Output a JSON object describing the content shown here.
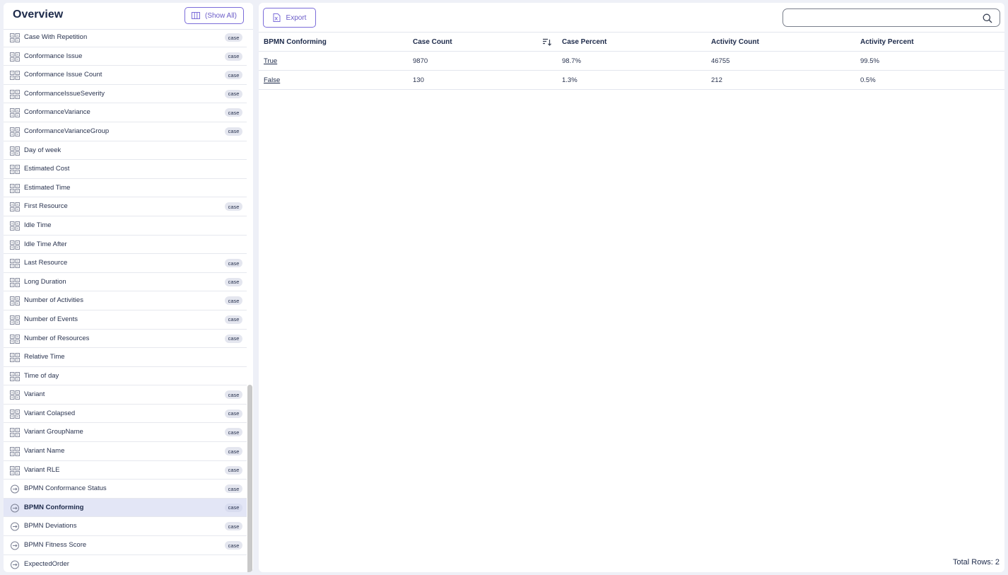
{
  "sidebar": {
    "title": "Overview",
    "show_all_label": "(Show All)",
    "items": [
      {
        "label": "Case With Repetition",
        "tag": "case",
        "icon": "grid-icon"
      },
      {
        "label": "Conformance Issue",
        "tag": "case",
        "icon": "grid-icon"
      },
      {
        "label": "Conformance Issue Count",
        "tag": "case",
        "icon": "grid-icon"
      },
      {
        "label": "ConformanceIssueSeverity",
        "tag": "case",
        "icon": "grid-icon"
      },
      {
        "label": "ConformanceVariance",
        "tag": "case",
        "icon": "grid-icon"
      },
      {
        "label": "ConformanceVarianceGroup",
        "tag": "case",
        "icon": "grid-icon"
      },
      {
        "label": "Day of week",
        "tag": "",
        "icon": "grid-icon"
      },
      {
        "label": "Estimated Cost",
        "tag": "",
        "icon": "grid-icon"
      },
      {
        "label": "Estimated Time",
        "tag": "",
        "icon": "grid-icon"
      },
      {
        "label": "First Resource",
        "tag": "case",
        "icon": "grid-icon"
      },
      {
        "label": "Idle Time",
        "tag": "",
        "icon": "grid-icon"
      },
      {
        "label": "Idle Time After",
        "tag": "",
        "icon": "grid-icon"
      },
      {
        "label": "Last Resource",
        "tag": "case",
        "icon": "grid-icon"
      },
      {
        "label": "Long Duration",
        "tag": "case",
        "icon": "grid-icon"
      },
      {
        "label": "Number of Activities",
        "tag": "case",
        "icon": "grid-icon"
      },
      {
        "label": "Number of Events",
        "tag": "case",
        "icon": "grid-icon"
      },
      {
        "label": "Number of Resources",
        "tag": "case",
        "icon": "grid-icon"
      },
      {
        "label": "Relative Time",
        "tag": "",
        "icon": "grid-icon"
      },
      {
        "label": "Time of day",
        "tag": "",
        "icon": "grid-icon"
      },
      {
        "label": "Variant",
        "tag": "case",
        "icon": "grid-icon"
      },
      {
        "label": "Variant Colapsed",
        "tag": "case",
        "icon": "grid-icon"
      },
      {
        "label": "Variant GroupName",
        "tag": "case",
        "icon": "grid-icon"
      },
      {
        "label": "Variant Name",
        "tag": "case",
        "icon": "grid-icon"
      },
      {
        "label": "Variant RLE",
        "tag": "case",
        "icon": "grid-icon"
      },
      {
        "label": "BPMN Conformance Status",
        "tag": "case",
        "icon": "bpmn-circle-icon"
      },
      {
        "label": "BPMN Conforming",
        "tag": "case",
        "icon": "bpmn-circle-icon",
        "selected": true
      },
      {
        "label": "BPMN Deviations",
        "tag": "case",
        "icon": "bpmn-circle-icon"
      },
      {
        "label": "BPMN Fitness Score",
        "tag": "case",
        "icon": "bpmn-circle-icon"
      },
      {
        "label": "ExpectedOrder",
        "tag": "",
        "icon": "bpmn-circle-icon"
      }
    ]
  },
  "toolbar": {
    "export_label": "Export",
    "search_value": ""
  },
  "table": {
    "columns": [
      "BPMN Conforming",
      "Case Count",
      "Case Percent",
      "Activity Count",
      "Activity Percent"
    ],
    "rows": [
      [
        "True",
        "9870",
        "98.7%",
        "46755",
        "99.5%"
      ],
      [
        "False",
        "130",
        "1.3%",
        "212",
        "0.5%"
      ]
    ],
    "total_rows_label": "Total Rows: 2"
  },
  "colors": {
    "accent": "#7b6cd9",
    "selected_row": "#e3e6f6",
    "background": "#eef0f7"
  }
}
